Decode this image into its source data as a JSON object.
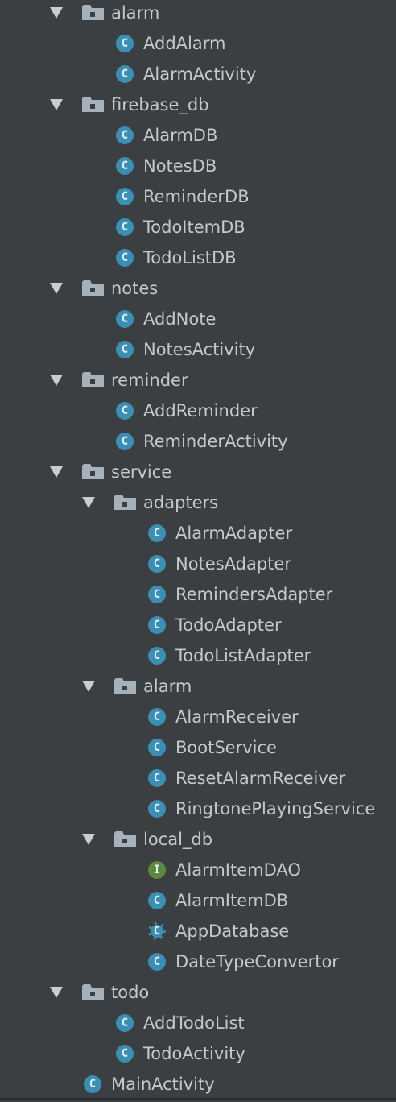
{
  "tree": [
    {
      "level": 0,
      "type": "package",
      "label": "alarm"
    },
    {
      "level": 1,
      "type": "class",
      "label": "AddAlarm"
    },
    {
      "level": 1,
      "type": "class",
      "label": "AlarmActivity"
    },
    {
      "level": 0,
      "type": "package",
      "label": "firebase_db"
    },
    {
      "level": 1,
      "type": "class",
      "label": "AlarmDB"
    },
    {
      "level": 1,
      "type": "class",
      "label": "NotesDB"
    },
    {
      "level": 1,
      "type": "class",
      "label": "ReminderDB"
    },
    {
      "level": 1,
      "type": "class",
      "label": "TodoItemDB"
    },
    {
      "level": 1,
      "type": "class",
      "label": "TodoListDB"
    },
    {
      "level": 0,
      "type": "package",
      "label": "notes"
    },
    {
      "level": 1,
      "type": "class",
      "label": "AddNote"
    },
    {
      "level": 1,
      "type": "class",
      "label": "NotesActivity"
    },
    {
      "level": 0,
      "type": "package",
      "label": "reminder"
    },
    {
      "level": 1,
      "type": "class",
      "label": "AddReminder"
    },
    {
      "level": 1,
      "type": "class",
      "label": "ReminderActivity"
    },
    {
      "level": 0,
      "type": "package",
      "label": "service"
    },
    {
      "level": 1,
      "type": "package",
      "label": "adapters"
    },
    {
      "level": 2,
      "type": "class",
      "label": "AlarmAdapter"
    },
    {
      "level": 2,
      "type": "class",
      "label": "NotesAdapter"
    },
    {
      "level": 2,
      "type": "class",
      "label": "RemindersAdapter"
    },
    {
      "level": 2,
      "type": "class",
      "label": "TodoAdapter"
    },
    {
      "level": 2,
      "type": "class",
      "label": "TodoListAdapter"
    },
    {
      "level": 1,
      "type": "package",
      "label": "alarm"
    },
    {
      "level": 2,
      "type": "class",
      "label": "AlarmReceiver"
    },
    {
      "level": 2,
      "type": "class",
      "label": "BootService"
    },
    {
      "level": 2,
      "type": "class",
      "label": "ResetAlarmReceiver"
    },
    {
      "level": 2,
      "type": "class",
      "label": "RingtonePlayingService"
    },
    {
      "level": 1,
      "type": "package",
      "label": "local_db"
    },
    {
      "level": 2,
      "type": "interface",
      "label": "AlarmItemDAO"
    },
    {
      "level": 2,
      "type": "class",
      "label": "AlarmItemDB"
    },
    {
      "level": 2,
      "type": "abstract",
      "label": "AppDatabase"
    },
    {
      "level": 2,
      "type": "class",
      "label": "DateTypeConvertor"
    },
    {
      "level": 0,
      "type": "package",
      "label": "todo"
    },
    {
      "level": 1,
      "type": "class",
      "label": "AddTodoList"
    },
    {
      "level": 1,
      "type": "class",
      "label": "TodoActivity"
    },
    {
      "level": 0,
      "type": "class",
      "label": "MainActivity"
    }
  ],
  "icons": {
    "class": {
      "glyph": "C",
      "color": "#3a90b4",
      "name": "class-icon"
    },
    "interface": {
      "glyph": "I",
      "color": "#5b8a3d",
      "name": "interface-icon"
    },
    "abstract": {
      "glyph": "C",
      "color": "#3a90b4",
      "name": "abstract-class-icon"
    },
    "package": {
      "color": "#a6b2bb",
      "name": "package-folder-icon"
    },
    "expand": {
      "name": "expanded-arrow-icon"
    }
  },
  "colors": {
    "background": "#3c3f41",
    "text": "#c5c9cc"
  }
}
